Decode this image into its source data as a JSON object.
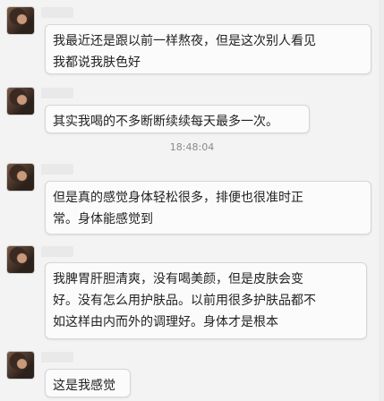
{
  "messages": [
    {
      "text": "我最近还是跟以前一样熬夜，但是这次别人看见\n我都说我肤色好"
    },
    {
      "text": "其实我喝的不多断断续续每天最多一次。"
    },
    {
      "text": "但是真的感觉身体轻松很多，排便也很准时正\n常。身体能感觉到"
    },
    {
      "text": "我脾胃肝胆清爽，没有喝美颜，但是皮肤会变\n好。没有怎么用护肤品。以前用很多护肤品都不\n如这样由内而外的调理好。身体才是根本"
    },
    {
      "text": "这是我感觉"
    }
  ],
  "timestamp": "18:48:04"
}
